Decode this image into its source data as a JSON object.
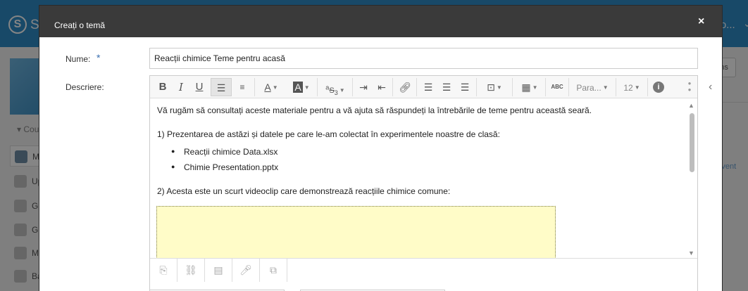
{
  "background": {
    "logo_letter": "S",
    "logo_text": "SC",
    "user_text": "Co...",
    "courses_label": "Cou",
    "nav_items": [
      "Ma",
      "Upc",
      "Gra",
      "Gra",
      "Ma",
      "Bac"
    ],
    "right_button": "ons",
    "event_link": "Event"
  },
  "modal": {
    "title": "Creați o temă",
    "close_label": "×",
    "name_label": "Nume:",
    "required_marker": "*",
    "name_value": "Reacții chimice Teme pentru acasă",
    "description_label": "Descriere:"
  },
  "toolbar": {
    "bold": "B",
    "italic": "I",
    "underline": "U",
    "paragraph_select": "Para...",
    "font_size_select": "12",
    "info": "i"
  },
  "description": {
    "intro": "Vă rugăm să consultați aceste materiale pentru a vă ajuta să răspundeți la întrebările de teme pentru această seară.",
    "item1": "1) Prezentarea de astăzi și datele pe care le-am colectat în experimentele noastre de clasă:",
    "files": [
      "Reacții chimice Data.xlsx",
      "Chimie Presentation.pptx"
    ],
    "item2": "2) Acesta este un scurt videoclip care demonstrează reacțiile chimice comune:"
  },
  "colors": {
    "header_bg": "#3a3a3a",
    "topbar": "#2f8cc7",
    "video_placeholder": "#fffcc8",
    "required_star": "#3a6fb0"
  }
}
